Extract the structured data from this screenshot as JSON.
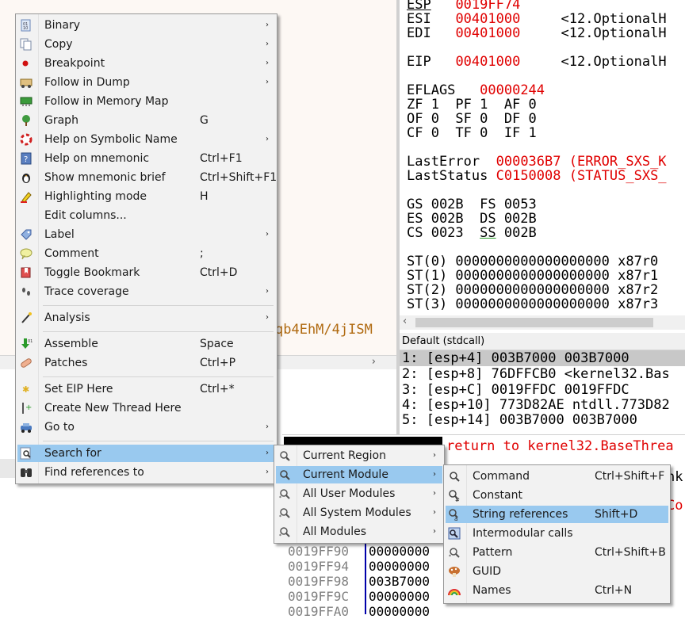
{
  "left_pane": {
    "base64_text": "qb4EhM/4jISM",
    "hscroll_arrow": "›"
  },
  "registers": {
    "esp": {
      "name": "ESP",
      "value": "0019FF74"
    },
    "esi": {
      "name": "ESI",
      "value": "00401000",
      "comment": "<12.OptionalH"
    },
    "edi": {
      "name": "EDI",
      "value": "00401000",
      "comment": "<12.OptionalH"
    },
    "eip": {
      "name": "EIP",
      "value": "00401000",
      "comment": "<12.OptionalH"
    },
    "eflags": {
      "name": "EFLAGS",
      "value": "00000244"
    },
    "flags_row1": "ZF 1  PF 1  AF 0",
    "flags_row2": "OF 0  SF 0  DF 0",
    "flags_row3": "CF 0  TF 0  IF 1",
    "lasterror": {
      "name": "LastError",
      "value": "000036B7 (ERROR_SXS_K"
    },
    "laststatus": {
      "name": "LastStatus",
      "value": "C0150008 (STATUS_SXS_"
    },
    "seg_row1": "GS 002B  FS 0053",
    "seg_row2": "ES 002B  DS 002B",
    "seg_row3_a": "CS 0023  ",
    "seg_row3_ss": "SS",
    "seg_row3_b": " 002B",
    "st0": "ST(0) 0000000000000000000 x87r0",
    "st1": "ST(1) 0000000000000000000 x87r1",
    "st2": "ST(2) 0000000000000000000 x87r2",
    "st3": "ST(3) 0000000000000000000 x87r3"
  },
  "stack_args": {
    "header": "Default (stdcall)",
    "rows": [
      "1: [esp+4] 003B7000 003B7000",
      "2: [esp+8] 76DFFCB0 <kernel32.Bas",
      "3: [esp+C] 0019FFDC 0019FFDC",
      "4: [esp+10] 773D82AE ntdll.773D82",
      "5: [esp+14] 003B7000 003B7000"
    ]
  },
  "dump": {
    "top_comment": "return to kernel32.BaseThrea",
    "frag1": "nk",
    "frag2": "Cor",
    "rows": [
      {
        "addr": "0019FF90",
        "val": "00000000"
      },
      {
        "addr": "0019FF94",
        "val": "00000000"
      },
      {
        "addr": "0019FF98",
        "val": "003B7000"
      },
      {
        "addr": "0019FF9C",
        "val": "00000000"
      },
      {
        "addr": "0019FFA0",
        "val": "00000000"
      }
    ]
  },
  "context_menu": {
    "items": [
      {
        "label": "Binary",
        "shortcut": "",
        "arrow": "›",
        "icon": "binary-icon"
      },
      {
        "label": "Copy",
        "shortcut": "",
        "arrow": "›",
        "icon": "copy-icon"
      },
      {
        "label": "Breakpoint",
        "shortcut": "",
        "arrow": "›",
        "icon": "breakpoint-icon"
      },
      {
        "label": "Follow in Dump",
        "shortcut": "",
        "arrow": "›",
        "icon": "dump-icon"
      },
      {
        "label": "Follow in Memory Map",
        "shortcut": "",
        "arrow": "",
        "icon": "memory-map-icon"
      },
      {
        "label": "Graph",
        "shortcut": "G",
        "arrow": "",
        "icon": "graph-icon"
      },
      {
        "label": "Help on Symbolic Name",
        "shortcut": "",
        "arrow": "›",
        "icon": "lifebuoy-icon"
      },
      {
        "label": "Help on mnemonic",
        "shortcut": "Ctrl+F1",
        "arrow": "",
        "icon": "help-icon"
      },
      {
        "label": "Show mnemonic brief",
        "shortcut": "Ctrl+Shift+F1",
        "arrow": "",
        "icon": "penguin-icon"
      },
      {
        "label": "Highlighting mode",
        "shortcut": "H",
        "arrow": "",
        "icon": "highlighter-icon"
      },
      {
        "label": "Edit columns...",
        "shortcut": "",
        "arrow": "",
        "icon": ""
      },
      {
        "label": "Label",
        "shortcut": "",
        "arrow": "›",
        "icon": "label-icon"
      },
      {
        "label": "Comment",
        "shortcut": ";",
        "arrow": "",
        "icon": "comment-icon"
      },
      {
        "label": "Toggle Bookmark",
        "shortcut": "Ctrl+D",
        "arrow": "",
        "icon": "bookmark-icon"
      },
      {
        "label": "Trace coverage",
        "shortcut": "",
        "arrow": "›",
        "icon": "footprints-icon"
      },
      {
        "label": "Analysis",
        "shortcut": "",
        "arrow": "›",
        "icon": "wand-icon"
      },
      {
        "label": "Assemble",
        "shortcut": "Space",
        "arrow": "",
        "icon": "assemble-icon"
      },
      {
        "label": "Patches",
        "shortcut": "Ctrl+P",
        "arrow": "",
        "icon": "bandage-icon"
      },
      {
        "label": "Set EIP Here",
        "shortcut": "Ctrl+*",
        "arrow": "",
        "icon": "star-icon"
      },
      {
        "label": "Create New Thread Here",
        "shortcut": "",
        "arrow": "",
        "icon": "thread-icon"
      },
      {
        "label": "Go to",
        "shortcut": "",
        "arrow": "›",
        "icon": "car-icon"
      },
      {
        "label": "Search for",
        "shortcut": "",
        "arrow": "›",
        "icon": "search-icon"
      },
      {
        "label": "Find references to",
        "shortcut": "",
        "arrow": "›",
        "icon": "binoculars-icon"
      }
    ]
  },
  "search_submenu": {
    "items": [
      {
        "label": "Current Region",
        "arrow": "›"
      },
      {
        "label": "Current Module",
        "arrow": "›"
      },
      {
        "label": "All User Modules",
        "arrow": "›"
      },
      {
        "label": "All System Modules",
        "arrow": "›"
      },
      {
        "label": "All Modules",
        "arrow": "›"
      }
    ]
  },
  "module_submenu": {
    "items": [
      {
        "label": "Command",
        "shortcut": "Ctrl+Shift+F",
        "icon": "search-icon"
      },
      {
        "label": "Constant",
        "shortcut": "",
        "icon": "hash-search-icon"
      },
      {
        "label": "String references",
        "shortcut": "Shift+D",
        "icon": "string-search-icon"
      },
      {
        "label": "Intermodular calls",
        "shortcut": "",
        "icon": "call-icon"
      },
      {
        "label": "Pattern",
        "shortcut": "Ctrl+Shift+B",
        "icon": "pattern-icon"
      },
      {
        "label": "GUID",
        "shortcut": "",
        "icon": "mushroom-icon"
      },
      {
        "label": "Names",
        "shortcut": "Ctrl+N",
        "icon": "rainbow-icon"
      }
    ]
  }
}
